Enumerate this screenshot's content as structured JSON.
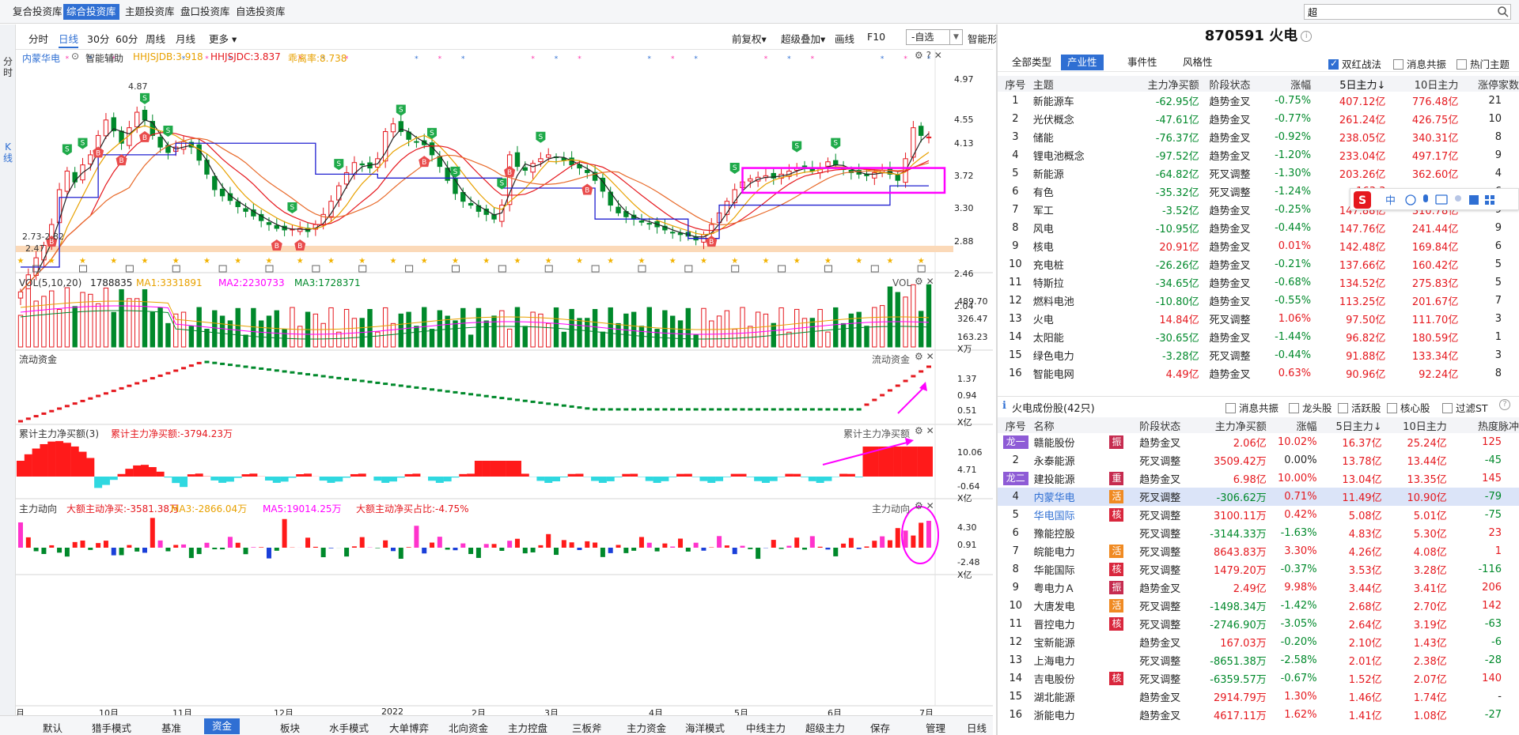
{
  "topbar": {
    "tabs": [
      "复合投资库",
      "综合投资库",
      "主题投资库",
      "盘口投资库",
      "自选投资库"
    ],
    "active": 1,
    "search_value": "超"
  },
  "left_strip": {
    "a": "分时",
    "b": "K线"
  },
  "toolbar": {
    "left": [
      "分时",
      "日线",
      "30分",
      "60分",
      "周线",
      "月线",
      "更多"
    ],
    "active": 1,
    "right": [
      "前复权",
      "超级叠加",
      "画线",
      "F10"
    ],
    "select": "-自选",
    "smart": "智能形态"
  },
  "kline": {
    "stock_name": "内蒙华电",
    "assist": "智能辅助",
    "ind1": "HHJSJDB:3.918",
    "ind2": "HHJSJDC:3.837",
    "ind3": "乖离率:8.738",
    "yticks": [
      "4.97",
      "4.55",
      "4.13",
      "3.72",
      "3.30",
      "2.88",
      "2.46",
      "2.04"
    ],
    "high_label": "4.87",
    "low_label1": "2.73-2.82",
    "low_label2": "2.47",
    "colors": {
      "up": "#e5181e",
      "down": "#00892b",
      "ma5": "#222222",
      "ma10": "#e8a100",
      "ma20": "#e5181e",
      "magenta": "#ff00ff",
      "blue_line": "#2020d0",
      "support": "#fbd9b8"
    },
    "series": [
      {
        "c": 2.18
      },
      {
        "c": 2.4
      },
      {
        "c": 2.62
      },
      {
        "c": 2.78
      },
      {
        "c": 3.05
      },
      {
        "c": 3.5
      },
      {
        "c": 3.74
      },
      {
        "c": 3.6
      },
      {
        "c": 3.82
      },
      {
        "c": 3.95
      },
      {
        "c": 4.2
      },
      {
        "c": 4.4
      },
      {
        "c": 4.26
      },
      {
        "c": 4.1
      },
      {
        "c": 4.3
      },
      {
        "c": 4.5
      },
      {
        "c": 4.4
      },
      {
        "c": 4.2
      },
      {
        "c": 4.05
      },
      {
        "c": 3.98
      },
      {
        "c": 4.05
      },
      {
        "c": 4.12
      },
      {
        "c": 4.05
      },
      {
        "c": 3.88
      },
      {
        "c": 3.7
      },
      {
        "c": 3.5
      },
      {
        "c": 3.42
      },
      {
        "c": 3.36
      },
      {
        "c": 3.28
      },
      {
        "c": 3.22
      },
      {
        "c": 3.16
      },
      {
        "c": 3.1
      },
      {
        "c": 3.05
      },
      {
        "c": 3.0
      },
      {
        "c": 2.98
      },
      {
        "c": 2.99
      },
      {
        "c": 3.0
      },
      {
        "c": 2.96
      },
      {
        "c": 3.05
      },
      {
        "c": 3.18
      },
      {
        "c": 3.35
      },
      {
        "c": 3.55
      },
      {
        "c": 3.72
      },
      {
        "c": 3.85
      },
      {
        "c": 3.82
      },
      {
        "c": 3.78
      },
      {
        "c": 3.9
      },
      {
        "c": 4.25
      },
      {
        "c": 4.35
      },
      {
        "c": 4.25
      },
      {
        "c": 4.15
      },
      {
        "c": 4.12
      },
      {
        "c": 4.08
      },
      {
        "c": 3.95
      },
      {
        "c": 3.8
      },
      {
        "c": 3.62
      },
      {
        "c": 3.45
      },
      {
        "c": 3.35
      },
      {
        "c": 3.3
      },
      {
        "c": 3.22
      },
      {
        "c": 3.18
      },
      {
        "c": 3.12
      },
      {
        "c": 3.3
      },
      {
        "c": 3.95
      },
      {
        "c": 3.8
      },
      {
        "c": 3.75
      },
      {
        "c": 3.84
      },
      {
        "c": 3.9
      },
      {
        "c": 3.95
      },
      {
        "c": 3.92
      },
      {
        "c": 3.88
      },
      {
        "c": 3.82
      },
      {
        "c": 3.78
      },
      {
        "c": 3.72
      },
      {
        "c": 3.62
      },
      {
        "c": 3.48
      },
      {
        "c": 3.3
      },
      {
        "c": 3.2
      },
      {
        "c": 3.15
      },
      {
        "c": 3.12
      },
      {
        "c": 3.08
      },
      {
        "c": 3.06
      },
      {
        "c": 3.02
      },
      {
        "c": 2.98
      },
      {
        "c": 2.94
      },
      {
        "c": 2.92
      },
      {
        "c": 2.9
      },
      {
        "c": 2.85
      },
      {
        "c": 2.92
      },
      {
        "c": 3.05
      },
      {
        "c": 3.2
      },
      {
        "c": 3.35
      },
      {
        "c": 3.5
      },
      {
        "c": 3.6
      },
      {
        "c": 3.64
      },
      {
        "c": 3.66
      },
      {
        "c": 3.68
      },
      {
        "c": 3.65
      },
      {
        "c": 3.7
      },
      {
        "c": 3.74
      },
      {
        "c": 3.78
      },
      {
        "c": 3.8
      },
      {
        "c": 3.74
      },
      {
        "c": 3.78
      },
      {
        "c": 3.86
      },
      {
        "c": 3.82
      },
      {
        "c": 3.76
      },
      {
        "c": 3.72
      },
      {
        "c": 3.7
      },
      {
        "c": 3.68
      },
      {
        "c": 3.72
      },
      {
        "c": 3.75
      },
      {
        "c": 3.7
      },
      {
        "c": 3.62
      },
      {
        "c": 3.9
      },
      {
        "c": 4.3
      },
      {
        "c": 4.2
      },
      {
        "c": 4.18
      }
    ]
  },
  "vol": {
    "title": "VOL(5,10,20)",
    "v": "1788835",
    "ma1": "MA1:3331891",
    "ma2": "MA2:2230733",
    "ma3": "MA3:1728371",
    "label": "VOL",
    "yticks": [
      "489.70",
      "326.47",
      "163.23"
    ],
    "unit": "X万"
  },
  "flow": {
    "title": "流动资金",
    "label": "流动资金",
    "yticks": [
      "1.37",
      "0.94",
      "0.51"
    ],
    "unit": "X亿"
  },
  "cum": {
    "title": "累计主力净买额(3)",
    "value": "累计主力净买额:-3794.23万",
    "label": "累计主力净买额",
    "yticks": [
      "10.06",
      "4.71",
      "-0.64"
    ],
    "unit": "X亿"
  },
  "main": {
    "title": "主力动向",
    "v1": "大额主动净买:-3581.38万",
    "v2": "MA3:-2866.04万",
    "v3": "MA5:19014.25万",
    "v4": "大额主动净买占比:-4.75%",
    "label": "主力动向",
    "yticks": [
      "4.30",
      "0.91",
      "-2.48"
    ],
    "unit": "X亿"
  },
  "xaxis": [
    "月",
    "10月",
    "11月",
    "12月",
    "2022",
    "2月",
    "3月",
    "4月",
    "5月",
    "6月",
    "7月"
  ],
  "bottombar": {
    "tabs": [
      "默认",
      "猎手模式",
      "基准",
      "资金",
      "板块",
      "水手模式",
      "大单博弈",
      "北向资金",
      "主力控盘",
      "三板斧",
      "主力资金",
      "海洋模式",
      "中线主力",
      "超级主力",
      "保存",
      "管理"
    ],
    "active": 3,
    "right": "日线"
  },
  "right": {
    "title": "870591 火电",
    "tabs": [
      "全部类型",
      "产业性",
      "事件性",
      "风格性"
    ],
    "active_tab": 1,
    "checks": [
      {
        "label": "双红战法",
        "on": true
      },
      {
        "label": "消息共振",
        "on": false
      },
      {
        "label": "热门主题",
        "on": false
      }
    ],
    "t1_headers": [
      "序号",
      "主题",
      "主力净买额",
      "阶段状态",
      "涨幅",
      "5日主力↓",
      "10日主力",
      "涨停家数"
    ],
    "t1_rows": [
      [
        "1",
        "新能源车",
        "-62.95亿",
        "趋势金叉",
        "-0.75%",
        "407.12亿",
        "776.48亿",
        "21"
      ],
      [
        "2",
        "光伏概念",
        "-47.61亿",
        "趋势金叉",
        "-0.77%",
        "261.24亿",
        "426.75亿",
        "10"
      ],
      [
        "3",
        "储能",
        "-76.37亿",
        "趋势金叉",
        "-0.92%",
        "238.05亿",
        "340.31亿",
        "8"
      ],
      [
        "4",
        "锂电池概念",
        "-97.52亿",
        "趋势金叉",
        "-1.20%",
        "233.04亿",
        "497.17亿",
        "9"
      ],
      [
        "5",
        "新能源",
        "-64.82亿",
        "死叉调整",
        "-1.30%",
        "203.26亿",
        "362.60亿",
        "4"
      ],
      [
        "6",
        "有色",
        "-35.32亿",
        "死叉调整",
        "-1.24%",
        "163.3",
        "",
        "6"
      ],
      [
        "7",
        "军工",
        "-3.52亿",
        "趋势金叉",
        "-0.25%",
        "147.88亿",
        "310.78亿",
        "9"
      ],
      [
        "8",
        "风电",
        "-10.95亿",
        "趋势金叉",
        "-0.44%",
        "147.76亿",
        "241.44亿",
        "9"
      ],
      [
        "9",
        "核电",
        "20.91亿",
        "趋势金叉",
        "0.01%",
        "142.48亿",
        "169.84亿",
        "6"
      ],
      [
        "10",
        "充电桩",
        "-26.26亿",
        "趋势金叉",
        "-0.21%",
        "137.66亿",
        "160.42亿",
        "5"
      ],
      [
        "11",
        "特斯拉",
        "-34.65亿",
        "趋势金叉",
        "-0.68%",
        "134.52亿",
        "275.83亿",
        "5"
      ],
      [
        "12",
        "燃料电池",
        "-10.80亿",
        "趋势金叉",
        "-0.55%",
        "113.25亿",
        "201.67亿",
        "7"
      ],
      [
        "13",
        "火电",
        "14.84亿",
        "死叉调整",
        "1.06%",
        "97.50亿",
        "111.70亿",
        "3"
      ],
      [
        "14",
        "太阳能",
        "-30.65亿",
        "趋势金叉",
        "-1.44%",
        "96.82亿",
        "180.59亿",
        "1"
      ],
      [
        "15",
        "绿色电力",
        "-3.28亿",
        "死叉调整",
        "-0.44%",
        "91.88亿",
        "133.34亿",
        "3"
      ],
      [
        "16",
        "智能电网",
        "4.49亿",
        "趋势金叉",
        "0.63%",
        "90.96亿",
        "92.24亿",
        "8"
      ]
    ],
    "t2_title": "火电成份股(42只)",
    "t2_checks": [
      "消息共振",
      "龙头股",
      "活跃股",
      "核心股",
      "过滤ST"
    ],
    "t2_headers": [
      "序号",
      "名称",
      "",
      "阶段状态",
      "主力净买额",
      "涨幅",
      "5日主力↓",
      "10日主力",
      "热度脉冲"
    ],
    "t2_rows": [
      {
        "n": "龙一",
        "name": "赣能股份",
        "tag": "振",
        "state": "趋势金叉",
        "net": "2.06亿",
        "chg": "10.02%",
        "d5": "16.37亿",
        "d10": "25.24亿",
        "heat": "125"
      },
      {
        "n": "2",
        "name": "永泰能源",
        "tag": "",
        "state": "死叉调整",
        "net": "3509.42万",
        "chg": "0.00%",
        "d5": "13.78亿",
        "d10": "13.44亿",
        "heat": "-45"
      },
      {
        "n": "龙二",
        "name": "建投能源",
        "tag": "重",
        "state": "趋势金叉",
        "net": "6.98亿",
        "chg": "10.00%",
        "d5": "13.04亿",
        "d10": "13.35亿",
        "heat": "145"
      },
      {
        "n": "4",
        "name": "内蒙华电",
        "tag": "活",
        "state": "死叉调整",
        "net": "-306.62万",
        "chg": "0.71%",
        "d5": "11.49亿",
        "d10": "10.90亿",
        "heat": "-79"
      },
      {
        "n": "5",
        "name": "华电国际",
        "tag": "核",
        "state": "死叉调整",
        "net": "3100.11万",
        "chg": "0.42%",
        "d5": "5.08亿",
        "d10": "5.01亿",
        "heat": "-75"
      },
      {
        "n": "6",
        "name": "豫能控股",
        "tag": "",
        "state": "死叉调整",
        "net": "-3144.33万",
        "chg": "-1.63%",
        "d5": "4.83亿",
        "d10": "5.30亿",
        "heat": "23"
      },
      {
        "n": "7",
        "name": "皖能电力",
        "tag": "活",
        "state": "死叉调整",
        "net": "8643.83万",
        "chg": "3.30%",
        "d5": "4.26亿",
        "d10": "4.08亿",
        "heat": "1"
      },
      {
        "n": "8",
        "name": "华能国际",
        "tag": "核",
        "state": "死叉调整",
        "net": "1479.20万",
        "chg": "-0.37%",
        "d5": "3.53亿",
        "d10": "3.28亿",
        "heat": "-116"
      },
      {
        "n": "9",
        "name": "粤电力Ａ",
        "tag": "振",
        "state": "趋势金叉",
        "net": "2.49亿",
        "chg": "9.98%",
        "d5": "3.44亿",
        "d10": "3.41亿",
        "heat": "206"
      },
      {
        "n": "10",
        "name": "大唐发电",
        "tag": "活",
        "state": "死叉调整",
        "net": "-1498.34万",
        "chg": "-1.42%",
        "d5": "2.68亿",
        "d10": "2.70亿",
        "heat": "142"
      },
      {
        "n": "11",
        "name": "晋控电力",
        "tag": "核",
        "state": "死叉调整",
        "net": "-2746.90万",
        "chg": "-3.05%",
        "d5": "2.64亿",
        "d10": "3.19亿",
        "heat": "-63"
      },
      {
        "n": "12",
        "name": "宝新能源",
        "tag": "",
        "state": "趋势金叉",
        "net": "167.03万",
        "chg": "-0.20%",
        "d5": "2.10亿",
        "d10": "1.43亿",
        "heat": "-6"
      },
      {
        "n": "13",
        "name": "上海电力",
        "tag": "",
        "state": "死叉调整",
        "net": "-8651.38万",
        "chg": "-2.58%",
        "d5": "2.01亿",
        "d10": "2.38亿",
        "heat": "-28"
      },
      {
        "n": "14",
        "name": "吉电股份",
        "tag": "核",
        "state": "死叉调整",
        "net": "-6359.57万",
        "chg": "-0.67%",
        "d5": "1.52亿",
        "d10": "2.07亿",
        "heat": "140"
      },
      {
        "n": "15",
        "name": "湖北能源",
        "tag": "",
        "state": "趋势金叉",
        "net": "2914.79万",
        "chg": "1.30%",
        "d5": "1.46亿",
        "d10": "1.74亿",
        "heat": "-"
      },
      {
        "n": "16",
        "name": "浙能电力",
        "tag": "",
        "state": "趋势金叉",
        "net": "4617.11万",
        "chg": "1.62%",
        "d5": "1.41亿",
        "d10": "1.08亿",
        "heat": "-27"
      }
    ]
  }
}
